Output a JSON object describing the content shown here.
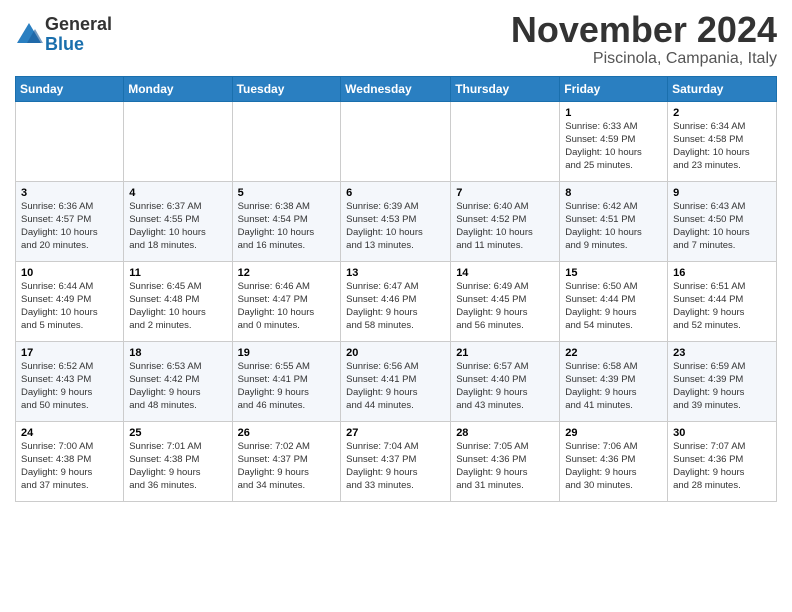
{
  "header": {
    "logo_line1": "General",
    "logo_line2": "Blue",
    "month": "November 2024",
    "location": "Piscinola, Campania, Italy"
  },
  "weekdays": [
    "Sunday",
    "Monday",
    "Tuesday",
    "Wednesday",
    "Thursday",
    "Friday",
    "Saturday"
  ],
  "weeks": [
    [
      {
        "day": "",
        "info": ""
      },
      {
        "day": "",
        "info": ""
      },
      {
        "day": "",
        "info": ""
      },
      {
        "day": "",
        "info": ""
      },
      {
        "day": "",
        "info": ""
      },
      {
        "day": "1",
        "info": "Sunrise: 6:33 AM\nSunset: 4:59 PM\nDaylight: 10 hours\nand 25 minutes."
      },
      {
        "day": "2",
        "info": "Sunrise: 6:34 AM\nSunset: 4:58 PM\nDaylight: 10 hours\nand 23 minutes."
      }
    ],
    [
      {
        "day": "3",
        "info": "Sunrise: 6:36 AM\nSunset: 4:57 PM\nDaylight: 10 hours\nand 20 minutes."
      },
      {
        "day": "4",
        "info": "Sunrise: 6:37 AM\nSunset: 4:55 PM\nDaylight: 10 hours\nand 18 minutes."
      },
      {
        "day": "5",
        "info": "Sunrise: 6:38 AM\nSunset: 4:54 PM\nDaylight: 10 hours\nand 16 minutes."
      },
      {
        "day": "6",
        "info": "Sunrise: 6:39 AM\nSunset: 4:53 PM\nDaylight: 10 hours\nand 13 minutes."
      },
      {
        "day": "7",
        "info": "Sunrise: 6:40 AM\nSunset: 4:52 PM\nDaylight: 10 hours\nand 11 minutes."
      },
      {
        "day": "8",
        "info": "Sunrise: 6:42 AM\nSunset: 4:51 PM\nDaylight: 10 hours\nand 9 minutes."
      },
      {
        "day": "9",
        "info": "Sunrise: 6:43 AM\nSunset: 4:50 PM\nDaylight: 10 hours\nand 7 minutes."
      }
    ],
    [
      {
        "day": "10",
        "info": "Sunrise: 6:44 AM\nSunset: 4:49 PM\nDaylight: 10 hours\nand 5 minutes."
      },
      {
        "day": "11",
        "info": "Sunrise: 6:45 AM\nSunset: 4:48 PM\nDaylight: 10 hours\nand 2 minutes."
      },
      {
        "day": "12",
        "info": "Sunrise: 6:46 AM\nSunset: 4:47 PM\nDaylight: 10 hours\nand 0 minutes."
      },
      {
        "day": "13",
        "info": "Sunrise: 6:47 AM\nSunset: 4:46 PM\nDaylight: 9 hours\nand 58 minutes."
      },
      {
        "day": "14",
        "info": "Sunrise: 6:49 AM\nSunset: 4:45 PM\nDaylight: 9 hours\nand 56 minutes."
      },
      {
        "day": "15",
        "info": "Sunrise: 6:50 AM\nSunset: 4:44 PM\nDaylight: 9 hours\nand 54 minutes."
      },
      {
        "day": "16",
        "info": "Sunrise: 6:51 AM\nSunset: 4:44 PM\nDaylight: 9 hours\nand 52 minutes."
      }
    ],
    [
      {
        "day": "17",
        "info": "Sunrise: 6:52 AM\nSunset: 4:43 PM\nDaylight: 9 hours\nand 50 minutes."
      },
      {
        "day": "18",
        "info": "Sunrise: 6:53 AM\nSunset: 4:42 PM\nDaylight: 9 hours\nand 48 minutes."
      },
      {
        "day": "19",
        "info": "Sunrise: 6:55 AM\nSunset: 4:41 PM\nDaylight: 9 hours\nand 46 minutes."
      },
      {
        "day": "20",
        "info": "Sunrise: 6:56 AM\nSunset: 4:41 PM\nDaylight: 9 hours\nand 44 minutes."
      },
      {
        "day": "21",
        "info": "Sunrise: 6:57 AM\nSunset: 4:40 PM\nDaylight: 9 hours\nand 43 minutes."
      },
      {
        "day": "22",
        "info": "Sunrise: 6:58 AM\nSunset: 4:39 PM\nDaylight: 9 hours\nand 41 minutes."
      },
      {
        "day": "23",
        "info": "Sunrise: 6:59 AM\nSunset: 4:39 PM\nDaylight: 9 hours\nand 39 minutes."
      }
    ],
    [
      {
        "day": "24",
        "info": "Sunrise: 7:00 AM\nSunset: 4:38 PM\nDaylight: 9 hours\nand 37 minutes."
      },
      {
        "day": "25",
        "info": "Sunrise: 7:01 AM\nSunset: 4:38 PM\nDaylight: 9 hours\nand 36 minutes."
      },
      {
        "day": "26",
        "info": "Sunrise: 7:02 AM\nSunset: 4:37 PM\nDaylight: 9 hours\nand 34 minutes."
      },
      {
        "day": "27",
        "info": "Sunrise: 7:04 AM\nSunset: 4:37 PM\nDaylight: 9 hours\nand 33 minutes."
      },
      {
        "day": "28",
        "info": "Sunrise: 7:05 AM\nSunset: 4:36 PM\nDaylight: 9 hours\nand 31 minutes."
      },
      {
        "day": "29",
        "info": "Sunrise: 7:06 AM\nSunset: 4:36 PM\nDaylight: 9 hours\nand 30 minutes."
      },
      {
        "day": "30",
        "info": "Sunrise: 7:07 AM\nSunset: 4:36 PM\nDaylight: 9 hours\nand 28 minutes."
      }
    ]
  ]
}
